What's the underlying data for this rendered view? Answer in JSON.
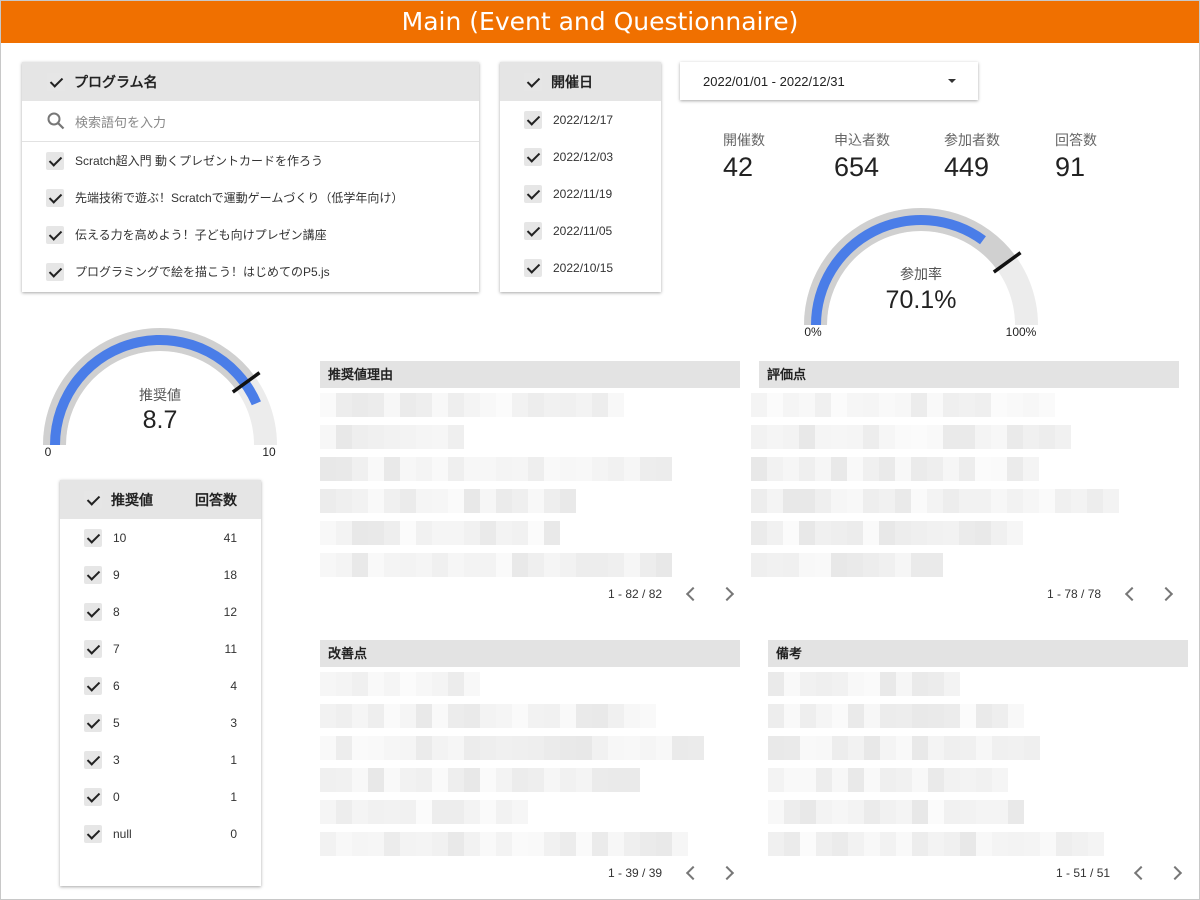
{
  "title": "Main (Event and Questionnaire)",
  "program_filter": {
    "header": "プログラム名",
    "search_placeholder": "検索語句を入力",
    "items": [
      "Scratch超入門 動くプレゼントカードを作ろう",
      "先端技術で遊ぶ！Scratchで運動ゲームづくり（低学年向け）",
      "伝える力を高めよう！子ども向けプレゼン講座",
      "プログラミングで絵を描こう！はじめてのP5.js"
    ]
  },
  "date_filter": {
    "header": "開催日",
    "items": [
      "2022/12/17",
      "2022/12/03",
      "2022/11/19",
      "2022/11/05",
      "2022/10/15"
    ]
  },
  "date_range": "2022/01/01 - 2022/12/31",
  "kpis": [
    {
      "label": "開催数",
      "value": "42"
    },
    {
      "label": "申込者数",
      "value": "654"
    },
    {
      "label": "参加者数",
      "value": "449"
    },
    {
      "label": "回答数",
      "value": "91"
    }
  ],
  "gauge_participation": {
    "label": "参加率",
    "value_text": "70.1%",
    "value": 70.1,
    "target": 80,
    "min_label": "0%",
    "max_label": "100%",
    "min": 0,
    "max": 100,
    "color": "#4a7de8"
  },
  "gauge_recommend": {
    "label": "推奨値",
    "value_text": "8.7",
    "value": 8.7,
    "target": 8,
    "min_label": "0",
    "max_label": "10",
    "min": 0,
    "max": 10,
    "color": "#4a7de8"
  },
  "recommend_table": {
    "col1": "推奨値",
    "col2": "回答数",
    "rows": [
      {
        "score": "10",
        "count": "41"
      },
      {
        "score": "9",
        "count": "18"
      },
      {
        "score": "8",
        "count": "12"
      },
      {
        "score": "7",
        "count": "11"
      },
      {
        "score": "6",
        "count": "4"
      },
      {
        "score": "5",
        "count": "3"
      },
      {
        "score": "3",
        "count": "1"
      },
      {
        "score": "0",
        "count": "1"
      },
      {
        "score": "null",
        "count": "0"
      }
    ]
  },
  "text_tables": [
    {
      "title": "推奨値理由",
      "pager": "1 - 82 / 82"
    },
    {
      "title": "評価点",
      "pager": "1 - 78 / 78"
    },
    {
      "title": "改善点",
      "pager": "1 - 39 / 39"
    },
    {
      "title": "備考",
      "pager": "1 - 51 / 51"
    }
  ],
  "colors": {
    "title_bar": "#f07000",
    "gauge_fill": "#4a7de8",
    "gauge_band": "#d0d0d0",
    "gauge_track": "#ececec"
  }
}
